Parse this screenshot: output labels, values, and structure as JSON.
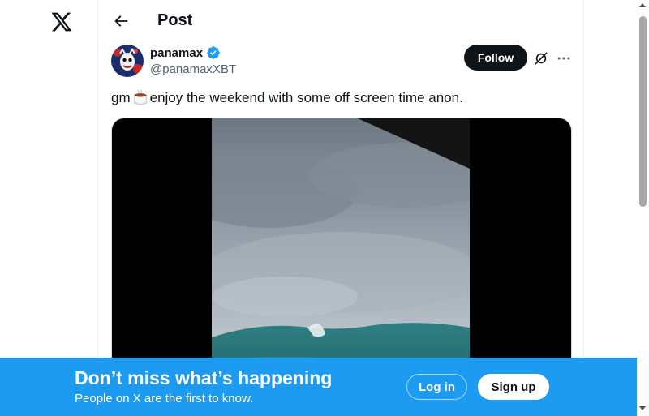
{
  "header": {
    "title": "Post"
  },
  "post": {
    "author_name": "panamax",
    "author_handle": "@panamaxXBT",
    "text_before": "gm",
    "text_after": "enjoy the weekend with some off screen time anon.",
    "follow_label": "Follow"
  },
  "banner": {
    "title": "Don’t miss what’s happening",
    "subtitle": "People on X are the first to know.",
    "login_label": "Log in",
    "signup_label": "Sign up"
  },
  "icons": {
    "logo": "x-logo-icon",
    "back": "back-arrow-icon",
    "verified": "verified-badge-icon",
    "grok": "grok-icon",
    "more": "more-icon",
    "coffee": "coffee-icon"
  },
  "colors": {
    "accent": "#1d9bf0",
    "text": "#0f1419",
    "secondary": "#536471",
    "button_dark": "#0f1419"
  }
}
